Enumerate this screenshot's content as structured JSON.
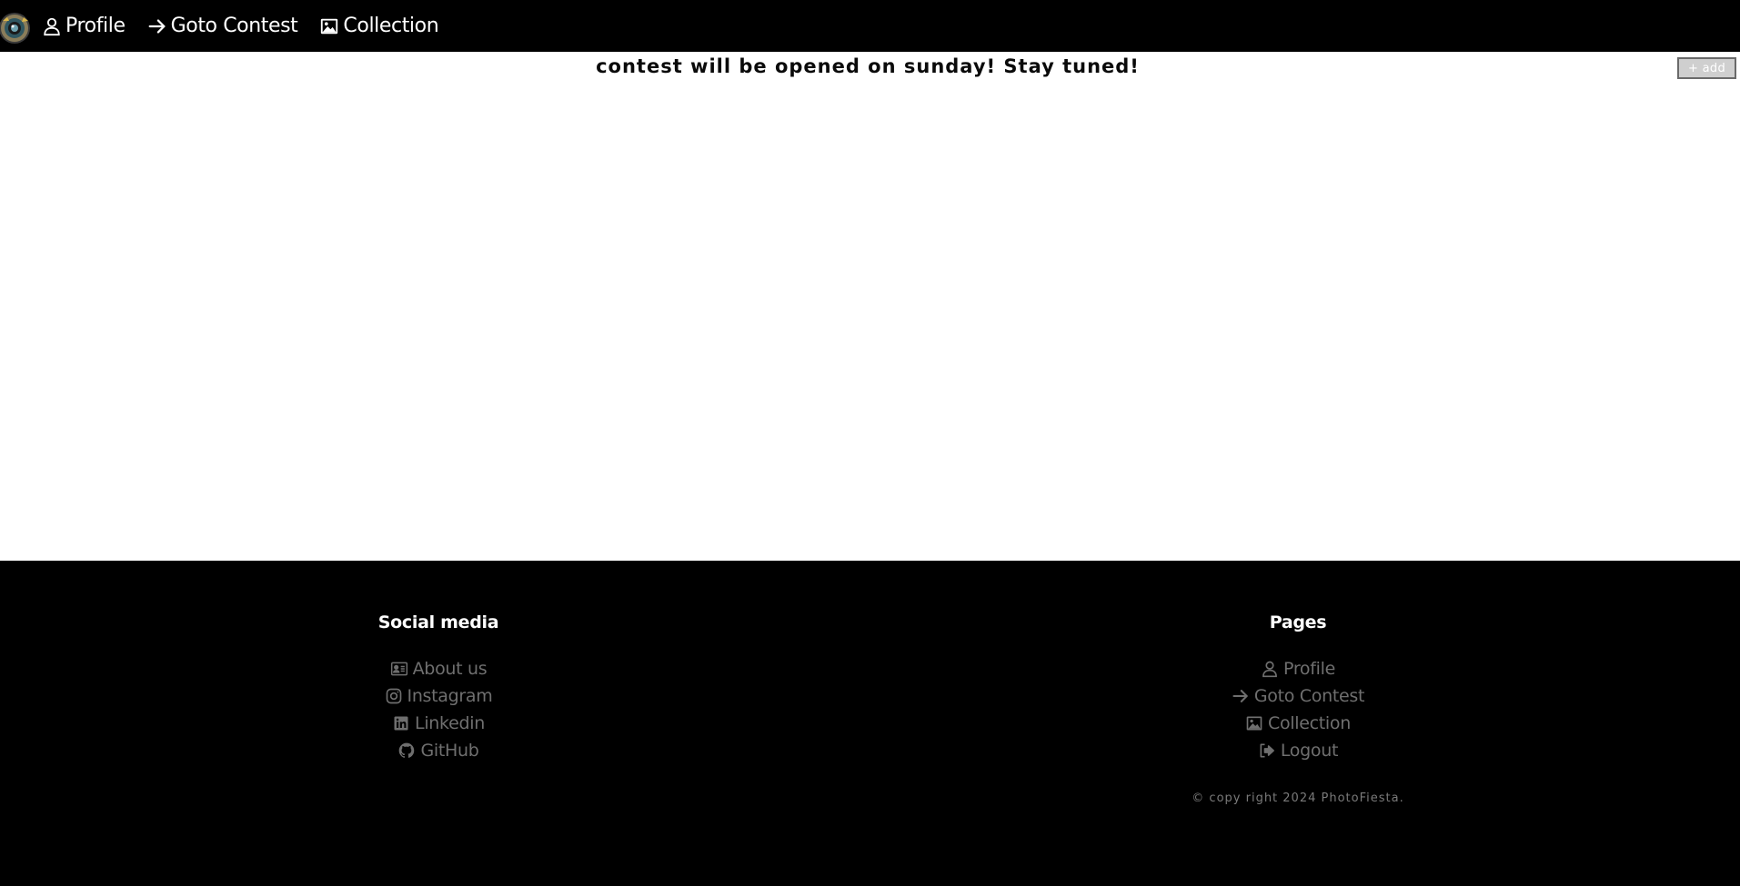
{
  "navbar": {
    "items": [
      {
        "label": "Profile",
        "icon": "person-icon"
      },
      {
        "label": "Goto Contest",
        "icon": "arrow-right-icon"
      },
      {
        "label": "Collection",
        "icon": "image-icon"
      }
    ]
  },
  "main": {
    "announcement": "contest will be opened on sunday! Stay tuned!",
    "add_button_label": "+ add"
  },
  "footer": {
    "social": {
      "heading": "Social media",
      "links": [
        {
          "label": "About us",
          "icon": "id-card-icon"
        },
        {
          "label": "Instagram",
          "icon": "instagram-icon"
        },
        {
          "label": "Linkedin",
          "icon": "linkedin-icon"
        },
        {
          "label": "GitHub",
          "icon": "github-icon"
        }
      ]
    },
    "pages": {
      "heading": "Pages",
      "links": [
        {
          "label": "Profile",
          "icon": "person-icon"
        },
        {
          "label": "Goto Contest",
          "icon": "arrow-right-icon"
        },
        {
          "label": "Collection",
          "icon": "image-icon"
        },
        {
          "label": "Logout",
          "icon": "logout-icon"
        }
      ]
    },
    "copyright": "© copy right 2024 PhotoFiesta."
  },
  "colors": {
    "nav_bg": "#000000",
    "footer_bg": "#000000",
    "footer_link": "#6f6f6f",
    "add_button_bg": "#cfcfcf"
  }
}
